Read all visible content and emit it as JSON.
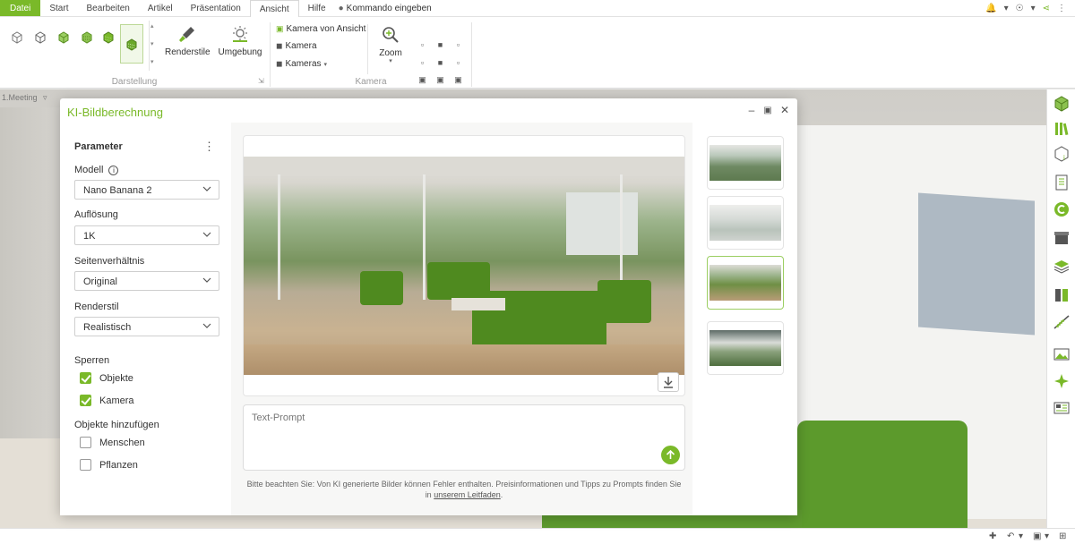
{
  "menu": {
    "tabs": [
      "Datei",
      "Start",
      "Bearbeiten",
      "Artikel",
      "Präsentation",
      "Ansicht",
      "Hilfe"
    ],
    "active_tab": "Ansicht",
    "command_label": "Kommando eingeben"
  },
  "ribbon": {
    "group_darstellung": "Darstellung",
    "group_kamera": "Kamera",
    "renderstile": "Renderstile",
    "umgebung": "Umgebung",
    "kamera_von_ansicht": "Kamera von Ansicht",
    "kamera": "Kamera",
    "kameras": "Kameras",
    "zoom": "Zoom"
  },
  "viewport": {
    "tab_label": "1.Meeting"
  },
  "dialog": {
    "title": "KI-Bildberechnung",
    "parameters_heading": "Parameter",
    "model_label": "Modell",
    "model_value": "Nano Banana 2",
    "resolution_label": "Auflösung",
    "resolution_value": "1K",
    "aspect_label": "Seitenverhältnis",
    "aspect_value": "Original",
    "renderstyle_label": "Renderstil",
    "renderstyle_value": "Realistisch",
    "lock_heading": "Sperren",
    "lock_objects": "Objekte",
    "lock_camera": "Kamera",
    "add_heading": "Objekte hinzufügen",
    "add_people": "Menschen",
    "add_plants": "Pflanzen",
    "prompt_placeholder": "Text-Prompt",
    "note_text": "Bitte beachten Sie: Von KI generierte Bilder können Fehler enthalten. Preisinformationen und Tipps zu Prompts finden Sie in",
    "note_link": "unserem Leitfaden",
    "note_end": "."
  },
  "colors": {
    "accent": "#7ab929",
    "sofa": "#4f8a1f"
  }
}
